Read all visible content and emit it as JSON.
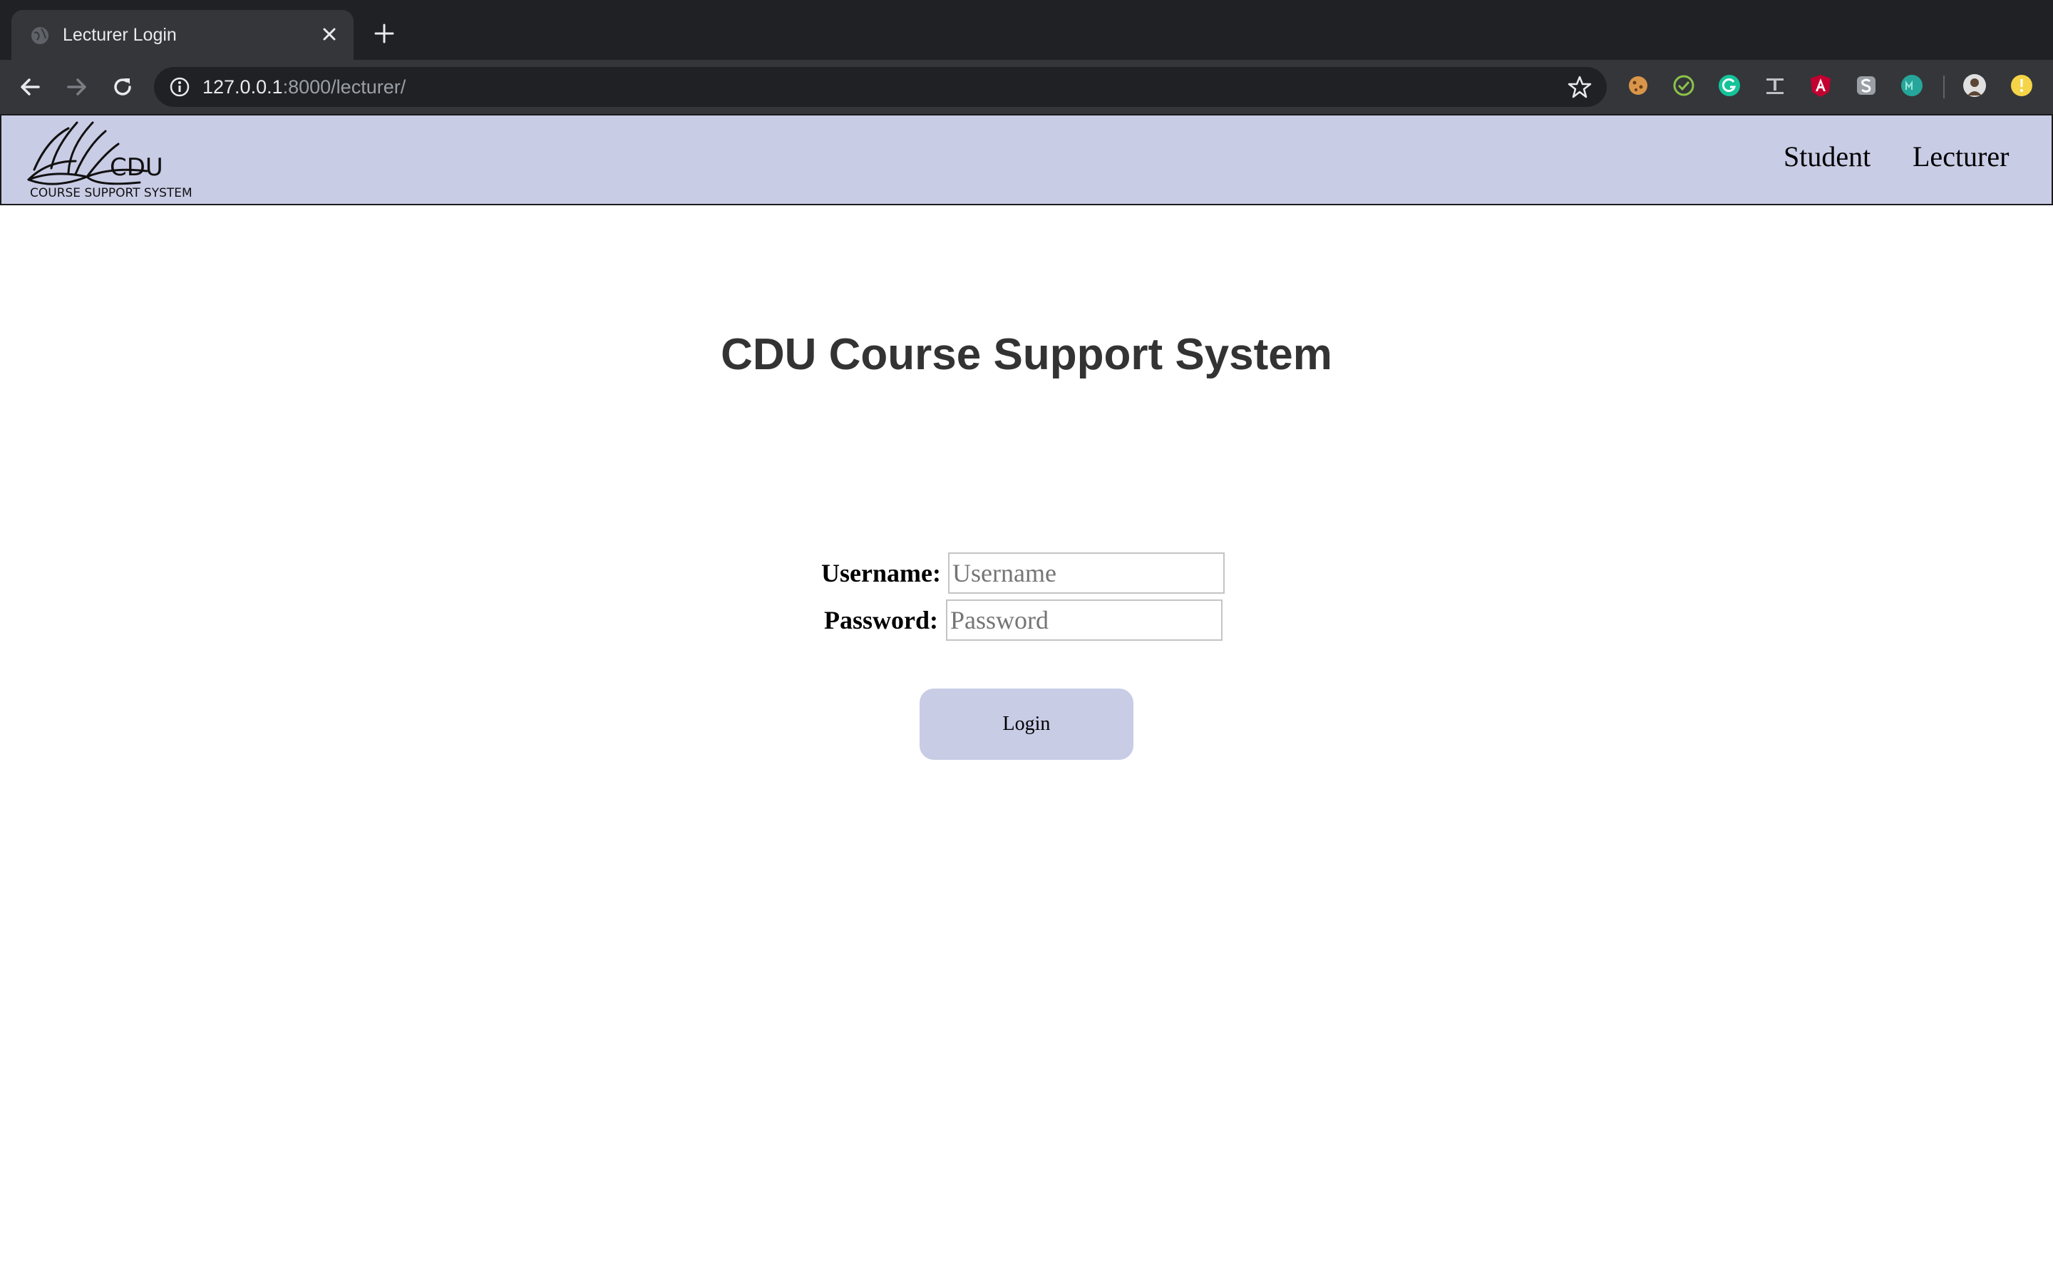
{
  "browser": {
    "tab_title": "Lecturer Login",
    "url_host": "127.0.0.1",
    "url_rest": ":8000/lecturer/"
  },
  "header": {
    "logo_text": "CDU",
    "logo_subtext": "COURSE SUPPORT SYSTEM",
    "nav": [
      "Student",
      "Lecturer"
    ]
  },
  "main": {
    "title": "CDU Course Support System",
    "username_label": "Username:",
    "username_placeholder": "Username",
    "username_value": "",
    "password_label": "Password:",
    "password_placeholder": "Password",
    "password_value": "",
    "login_label": "Login"
  },
  "colors": {
    "header_bg": "#c9cce5",
    "button_bg": "#c9cce5",
    "title_color": "#333333"
  },
  "icons": [
    "globe-icon",
    "close-icon",
    "plus-icon",
    "back-arrow-icon",
    "forward-arrow-icon",
    "reload-icon",
    "info-icon",
    "star-icon",
    "cookie-extension-icon",
    "check-extension-icon",
    "grammarly-icon",
    "text-extension-icon",
    "angular-icon",
    "s-extension-icon",
    "m-extension-icon",
    "profile-avatar-icon",
    "update-icon"
  ]
}
